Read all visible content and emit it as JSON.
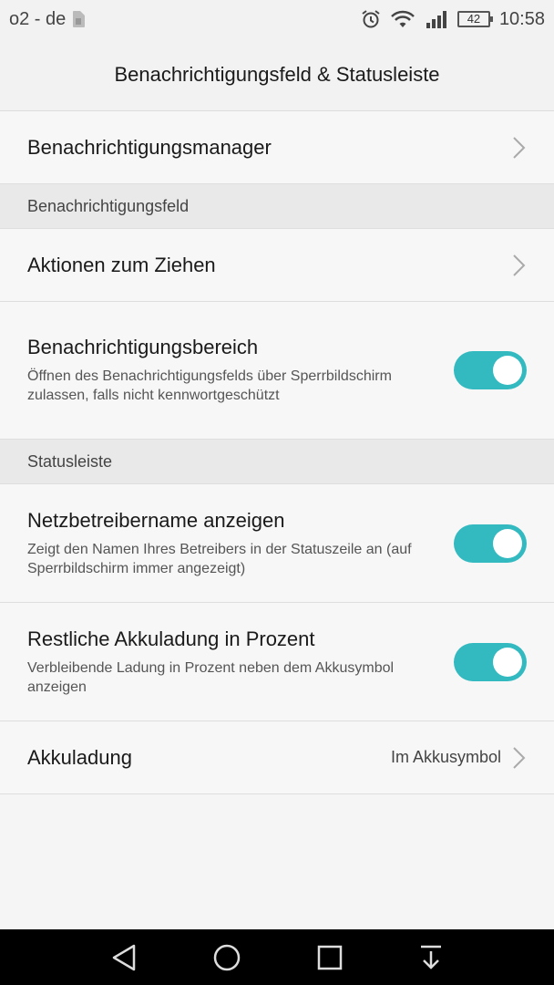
{
  "status_bar": {
    "carrier": "o2 - de",
    "battery_level": "42",
    "time": "10:58",
    "icons": [
      "sim-icon",
      "alarm-icon",
      "wifi-icon",
      "signal-icon",
      "battery-icon"
    ]
  },
  "header": {
    "title": "Benachrichtigungsfeld & Statusleiste"
  },
  "items": {
    "manager": {
      "title": "Benachrichtigungsmanager"
    },
    "section_panel": "Benachrichtigungsfeld",
    "drag_actions": {
      "title": "Aktionen zum Ziehen"
    },
    "notification_area": {
      "title": "Benachrichtigungsbereich",
      "desc": "Öffnen des Benachrichtigungsfelds über Sperrbildschirm zulassen, falls nicht kennwortgeschützt",
      "enabled": true
    },
    "section_statusbar": "Statusleiste",
    "carrier_name": {
      "title": "Netzbetreibername anzeigen",
      "desc": "Zeigt den Namen Ihres Betreibers in der Statuszeile an (auf Sperrbildschirm immer angezeigt)",
      "enabled": true
    },
    "battery_percent": {
      "title": "Restliche Akkuladung in Prozent",
      "desc": "Verbleibende Ladung in Prozent neben dem Akkusymbol anzeigen",
      "enabled": true
    },
    "battery_display": {
      "title": "Akkuladung",
      "value": "Im Akkusymbol"
    }
  },
  "colors": {
    "toggle_on": "#33b9c0",
    "background": "#f5f5f5",
    "navbar": "#000000"
  },
  "navbar": {
    "icons": [
      "back-icon",
      "home-icon",
      "recents-icon",
      "notification-pulldown-icon"
    ]
  }
}
